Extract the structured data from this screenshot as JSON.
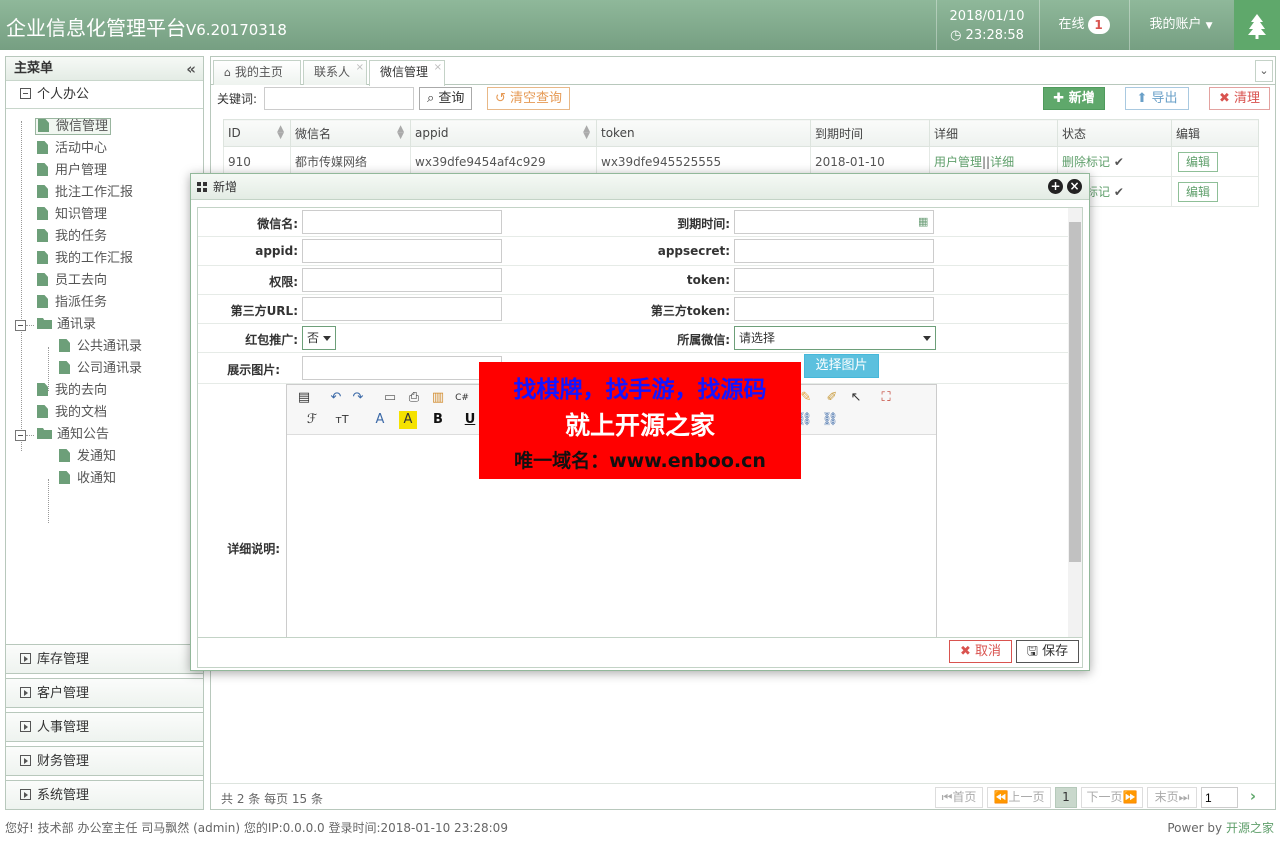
{
  "header": {
    "title": "企业信息化管理平台",
    "version": "V6.20170318",
    "date": "2018/01/10",
    "time": "23:28:58",
    "online_label": "在线",
    "online_count": "1",
    "account_label": "我的账户",
    "accent_color": "#5fa86b"
  },
  "sidebar": {
    "title": "主菜单",
    "group_label": "个人办公",
    "items": [
      {
        "label": "微信管理"
      },
      {
        "label": "活动中心"
      },
      {
        "label": "用户管理"
      },
      {
        "label": "批注工作汇报"
      },
      {
        "label": "知识管理"
      },
      {
        "label": "我的任务"
      },
      {
        "label": "我的工作汇报"
      },
      {
        "label": "员工去向"
      },
      {
        "label": "指派任务"
      },
      {
        "label": "通讯录"
      },
      {
        "label": "公共通讯录"
      },
      {
        "label": "公司通讯录"
      },
      {
        "label": "我的去向"
      },
      {
        "label": "我的文档"
      },
      {
        "label": "通知公告"
      },
      {
        "label": "发通知"
      },
      {
        "label": "收通知"
      }
    ],
    "groups": [
      "库存管理",
      "客户管理",
      "人事管理",
      "财务管理",
      "系统管理"
    ]
  },
  "tabs": [
    {
      "label": "我的主页"
    },
    {
      "label": "联系人"
    },
    {
      "label": "微信管理"
    }
  ],
  "toolbar": {
    "keyword_label": "关键词:",
    "keyword_value": "",
    "query_label": "查询",
    "clear_query_label": "清空查询",
    "add_label": "新增",
    "export_label": "导出",
    "clean_label": "清理"
  },
  "table": {
    "columns": [
      "ID",
      "微信名",
      "appid",
      "token",
      "到期时间",
      "详细",
      "状态",
      "编辑"
    ],
    "rows": [
      {
        "id": "910",
        "name": "都市传媒网络",
        "appid": "wx39dfe9454af4c929",
        "token": "wx39dfe945525555",
        "expire": "2018-01-10",
        "detail_link1": "用户管理",
        "detail_sep": "||",
        "detail_link2": "详细",
        "status": "删除标记",
        "edit": "编辑"
      },
      {
        "status": "删除标记",
        "edit": "编辑"
      }
    ]
  },
  "pager": {
    "info": "共 2 条 每页 15 条",
    "first": "首页",
    "prev": "上一页",
    "current": "1",
    "next": "下一页",
    "last": "末页",
    "page_input": "1"
  },
  "modal": {
    "title": "新增",
    "fields": {
      "wechat_name": "微信名:",
      "expire": "到期时间:",
      "appid": "appid:",
      "appsecret": "appsecret:",
      "permission": "权限:",
      "token": "token:",
      "third_url": "第三方URL:",
      "third_token": "第三方token:",
      "red_packet": "红包推广:",
      "red_packet_value": "否",
      "belong": "所属微信:",
      "belong_value": "请选择",
      "image": "展示图片:",
      "pick_image": "选择图片",
      "detail": "详细说明:"
    },
    "cancel_label": "取消",
    "save_label": "保存"
  },
  "ad": {
    "line1": "找棋牌，找手游，找源码",
    "line2": "就上开源之家",
    "line3": "唯一域名：www.enboo.cn"
  },
  "status": {
    "left": "您好! 技术部 办公室主任 司马飘然 (admin) 您的IP:0.0.0.0 登录时间:2018-01-10 23:28:09",
    "right_prefix": "Power by",
    "right_brand": "开源之家"
  }
}
